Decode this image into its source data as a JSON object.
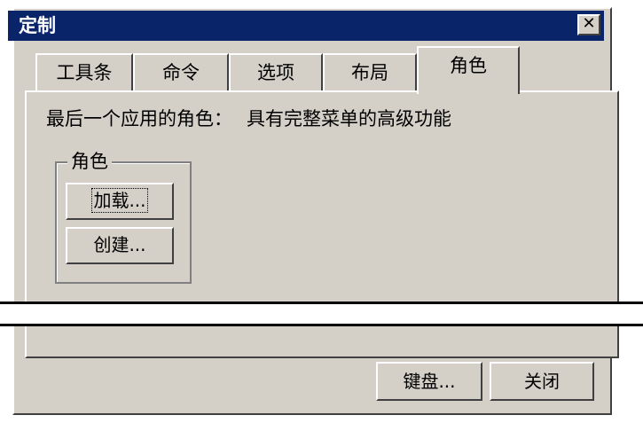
{
  "window": {
    "title": "定制",
    "close_glyph": "✕"
  },
  "tabs": [
    {
      "label": "工具条",
      "active": false
    },
    {
      "label": "命令",
      "active": false
    },
    {
      "label": "选项",
      "active": false
    },
    {
      "label": "布局",
      "active": false
    },
    {
      "label": "角色",
      "active": true
    }
  ],
  "panel": {
    "last_role_label": "最后一个应用的角色：",
    "last_role_value": "具有完整菜单的高级功能",
    "group_title": "角色",
    "load_button": "加载...",
    "create_button": "创建..."
  },
  "footer": {
    "keyboard_button": "键盘...",
    "close_button": "关闭"
  },
  "colors": {
    "titlebar": "#0a246a",
    "face": "#d4d0c8"
  }
}
